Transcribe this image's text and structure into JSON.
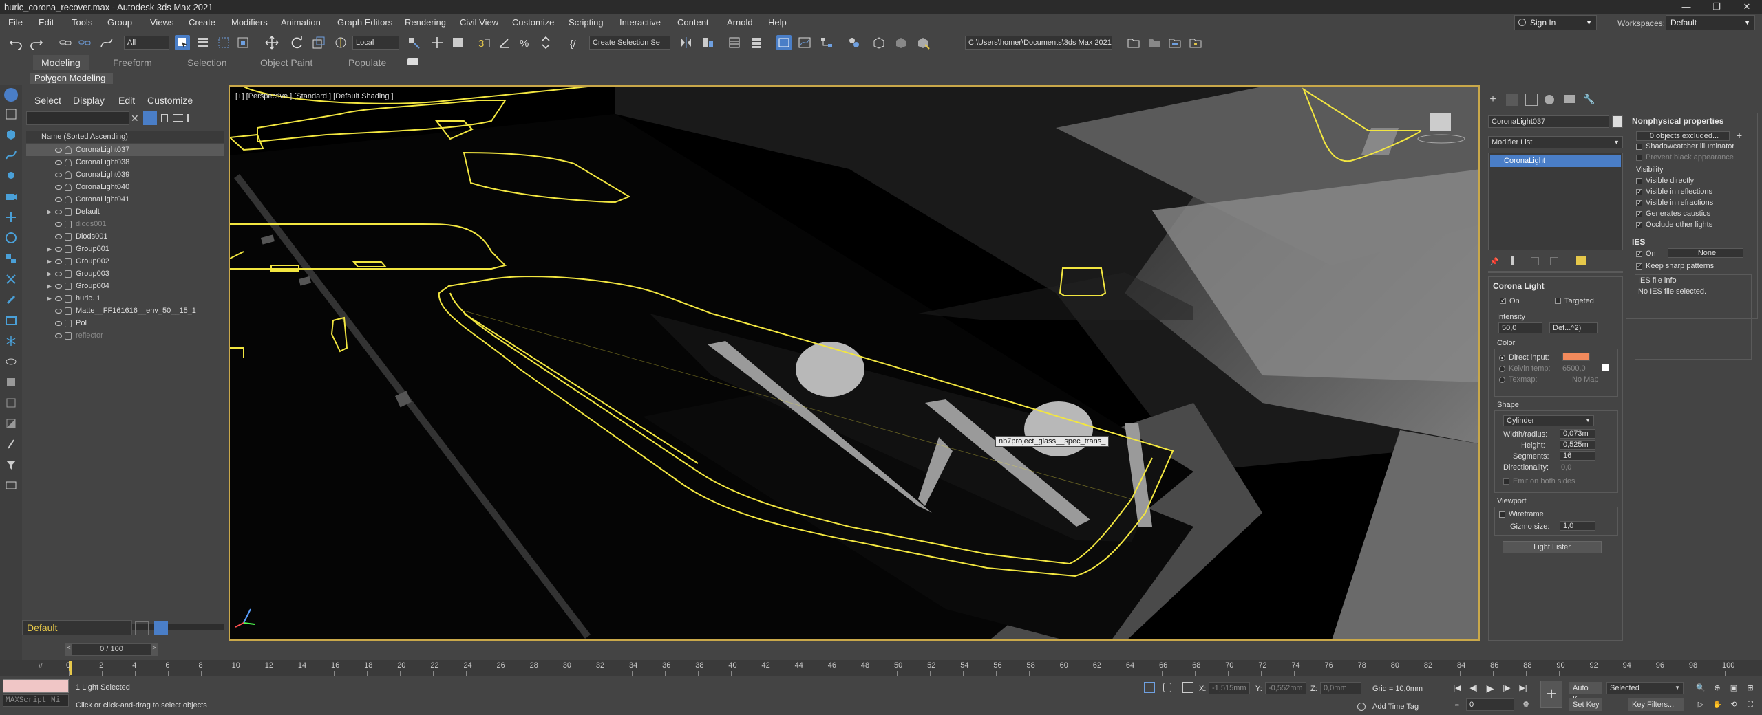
{
  "window": {
    "title": "huric_corona_recover.max - Autodesk 3ds Max 2021",
    "controls": [
      "—",
      "❐",
      "✕"
    ]
  },
  "menubar": {
    "items": [
      "File",
      "Edit",
      "Tools",
      "Group",
      "Views",
      "Create",
      "Modifiers",
      "Animation",
      "Graph Editors",
      "Rendering",
      "Civil View",
      "Customize",
      "Scripting",
      "Interactive",
      "Content",
      "Arnold",
      "Help"
    ],
    "sign_in": "Sign In",
    "workspaces_label": "Workspaces:",
    "workspace_value": "Default"
  },
  "toolbar": {
    "selection_filter": "All",
    "ref_coord": "Local",
    "named_selection": "Create Selection Se",
    "project_path": "C:\\Users\\homer\\Documents\\3ds Max 2021"
  },
  "ribbon": {
    "tabs": [
      "Modeling",
      "Freeform",
      "Selection",
      "Object Paint",
      "Populate"
    ],
    "active_tab": "Modeling",
    "panel_label": "Polygon Modeling"
  },
  "scene_explorer": {
    "tabs": [
      "Select",
      "Display",
      "Edit",
      "Customize"
    ],
    "column_header": "Name (Sorted Ascending)",
    "rows": [
      {
        "label": "CoronaLight037",
        "selected": true,
        "dim": false,
        "expand": false
      },
      {
        "label": "CoronaLight038",
        "selected": false,
        "dim": false,
        "expand": false
      },
      {
        "label": "CoronaLight039",
        "selected": false,
        "dim": false,
        "expand": false
      },
      {
        "label": "CoronaLight040",
        "selected": false,
        "dim": false,
        "expand": false
      },
      {
        "label": "CoronaLight041",
        "selected": false,
        "dim": false,
        "expand": false
      },
      {
        "label": "Default",
        "selected": false,
        "dim": false,
        "expand": true
      },
      {
        "label": "diods001",
        "selected": false,
        "dim": true,
        "expand": false
      },
      {
        "label": "Diods001",
        "selected": false,
        "dim": false,
        "expand": false
      },
      {
        "label": "Group001",
        "selected": false,
        "dim": false,
        "expand": true
      },
      {
        "label": "Group002",
        "selected": false,
        "dim": false,
        "expand": true
      },
      {
        "label": "Group003",
        "selected": false,
        "dim": false,
        "expand": true
      },
      {
        "label": "Group004",
        "selected": false,
        "dim": false,
        "expand": true
      },
      {
        "label": "huric. 1",
        "selected": false,
        "dim": false,
        "expand": true
      },
      {
        "label": "Matte__FF161616__env_50__15_1",
        "selected": false,
        "dim": false,
        "expand": false
      },
      {
        "label": "Pol",
        "selected": false,
        "dim": false,
        "expand": false
      },
      {
        "label": "reflector",
        "selected": false,
        "dim": true,
        "expand": false
      }
    ],
    "layer": "Default",
    "frame_counter": "0 / 100"
  },
  "viewport": {
    "label": "[+] [Perspective ] [Standard ] [Default Shading ]",
    "tooltip": "nb7project_glass__spec_trans_"
  },
  "command_panel": {
    "object_name": "CoronaLight037",
    "modifier_list": "Modifier List",
    "stack_item": "CoronaLight",
    "corona_light": {
      "title": "Corona Light",
      "on_label": "On",
      "targeted_label": "Targeted",
      "intensity_label": "Intensity",
      "intensity_value": "50,0",
      "intensity_unit": "Def...^2)",
      "color_label": "Color",
      "direct_input_label": "Direct input:",
      "direct_input_color": "#f28a5c",
      "kelvin_label": "Kelvin temp:",
      "kelvin_value": "6500,0",
      "texmap_label": "Texmap:",
      "texmap_value": "No Map",
      "shape_label": "Shape",
      "shape_value": "Cylinder",
      "width_label": "Width/radius:",
      "width_value": "0,073m",
      "height_label": "Height:",
      "height_value": "0,525m",
      "segments_label": "Segments:",
      "segments_value": "16",
      "directionality_label": "Directionality:",
      "directionality_value": "0,0",
      "emit_both_label": "Emit on both sides",
      "viewport_label": "Viewport",
      "wireframe_label": "Wireframe",
      "gizmo_label": "Gizmo size:",
      "gizmo_value": "1,0",
      "light_lister": "Light Lister"
    },
    "nonphysical": {
      "title": "Nonphysical properties",
      "excluded": "0 objects excluded...",
      "shadowcatcher": "Shadowcatcher illuminator",
      "prevent_black": "Prevent black appearance",
      "visibility_label": "Visibility",
      "visible_directly": "Visible directly",
      "visible_reflections": "Visible in reflections",
      "visible_refractions": "Visible in refractions",
      "generates_caustics": "Generates caustics",
      "occlude_lights": "Occlude other lights"
    },
    "ies": {
      "title": "IES",
      "on_label": "On",
      "none_btn": "None",
      "keep_sharp": "Keep sharp patterns",
      "file_info_label": "IES file info",
      "file_info_value": "No IES file selected."
    }
  },
  "timeline": {
    "ticks": [
      "0",
      "2",
      "4",
      "6",
      "8",
      "10",
      "12",
      "14",
      "16",
      "18",
      "20",
      "22",
      "24",
      "26",
      "28",
      "30",
      "32",
      "34",
      "36",
      "38",
      "40",
      "42",
      "44",
      "46",
      "48",
      "50",
      "52",
      "54",
      "56",
      "58",
      "60",
      "62",
      "64",
      "66",
      "68",
      "70",
      "72",
      "74",
      "76",
      "78",
      "80",
      "82",
      "84",
      "86",
      "88",
      "90",
      "92",
      "94",
      "96",
      "98",
      "100"
    ]
  },
  "statusbar": {
    "maxscript_placeholder": "MAXScript Mi",
    "status_line_1": "1 Light Selected",
    "status_line_2": "Click or click-and-drag to select objects",
    "x_label": "X:",
    "x_value": "-1,515mm",
    "y_label": "Y:",
    "y_value": "-0,552mm",
    "z_label": "Z:",
    "z_value": "0,0mm",
    "grid": "Grid = 10,0mm",
    "add_time_tag": "Add Time Tag",
    "frame_field": "0",
    "auto_key": "Auto K...",
    "set_key": "Set Key",
    "selected_dd": "Selected",
    "key_filters": "Key Filters..."
  },
  "colors": {
    "viewport_border": "#c9a84a",
    "selection_outline": "#f2e640",
    "accent_blue": "#4a7ec7"
  }
}
